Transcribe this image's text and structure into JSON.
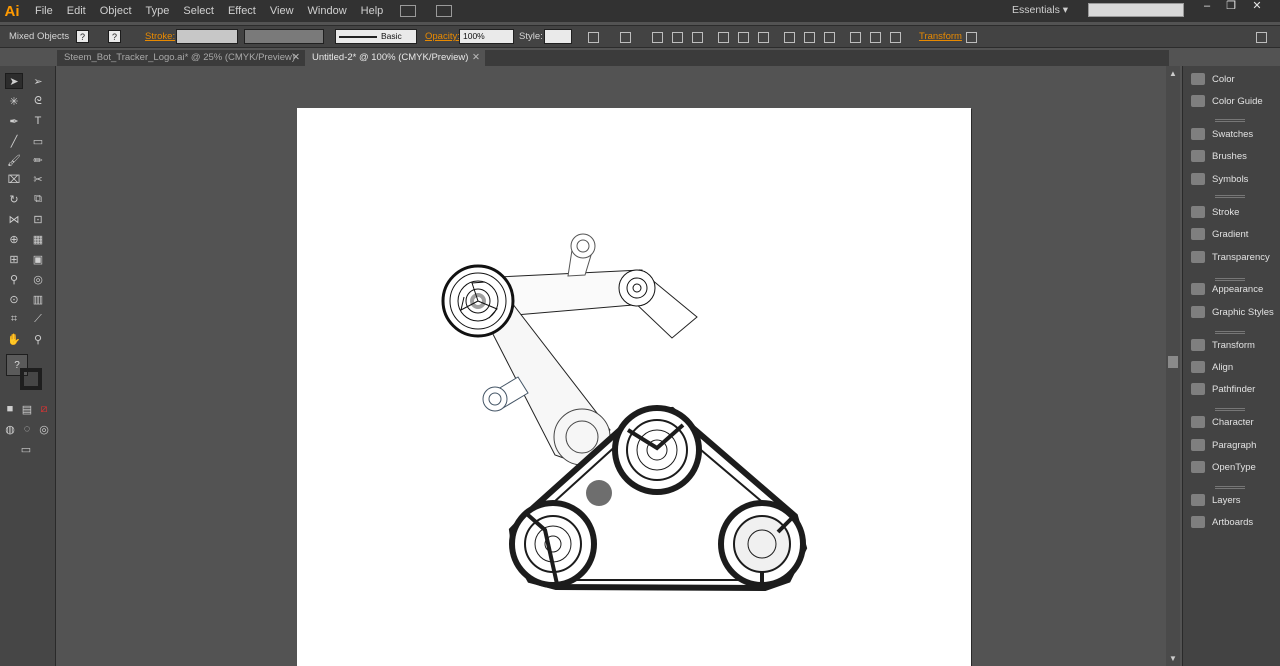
{
  "app": {
    "logo": "Ai",
    "workspace": "Essentials"
  },
  "menu": [
    "File",
    "Edit",
    "Object",
    "Type",
    "Select",
    "Effect",
    "View",
    "Window",
    "Help"
  ],
  "control_bar": {
    "selection": "Mixed Objects",
    "stroke_label": "Stroke:",
    "brush_label": "Basic",
    "opacity_label": "Opacity:",
    "opacity_value": "100%",
    "style_label": "Style:",
    "transform_label": "Transform"
  },
  "tabs": [
    {
      "label": "Steem_Bot_Tracker_Logo.ai* @ 25% (CMYK/Preview)",
      "active": false
    },
    {
      "label": "Untitled-2* @ 100% (CMYK/Preview)",
      "active": true
    }
  ],
  "panels": [
    {
      "label": "Color",
      "icon": "color-icon"
    },
    {
      "label": "Color Guide",
      "icon": "color-guide-icon"
    },
    {
      "label": "Swatches",
      "icon": "swatches-icon"
    },
    {
      "label": "Brushes",
      "icon": "brushes-icon"
    },
    {
      "label": "Symbols",
      "icon": "symbols-icon"
    },
    {
      "label": "Stroke",
      "icon": "stroke-icon"
    },
    {
      "label": "Gradient",
      "icon": "gradient-icon"
    },
    {
      "label": "Transparency",
      "icon": "transparency-icon"
    },
    {
      "label": "Appearance",
      "icon": "appearance-icon"
    },
    {
      "label": "Graphic Styles",
      "icon": "graphic-styles-icon"
    },
    {
      "label": "Transform",
      "icon": "transform-icon"
    },
    {
      "label": "Align",
      "icon": "align-icon"
    },
    {
      "label": "Pathfinder",
      "icon": "pathfinder-icon"
    },
    {
      "label": "Character",
      "icon": "character-icon"
    },
    {
      "label": "Paragraph",
      "icon": "paragraph-icon"
    },
    {
      "label": "OpenType",
      "icon": "opentype-icon"
    },
    {
      "label": "Layers",
      "icon": "layers-icon"
    },
    {
      "label": "Artboards",
      "icon": "artboards-icon"
    }
  ],
  "colors": {
    "accent": "#e98a00",
    "logo": "#ff9a00",
    "canvas_bg": "#535353"
  }
}
